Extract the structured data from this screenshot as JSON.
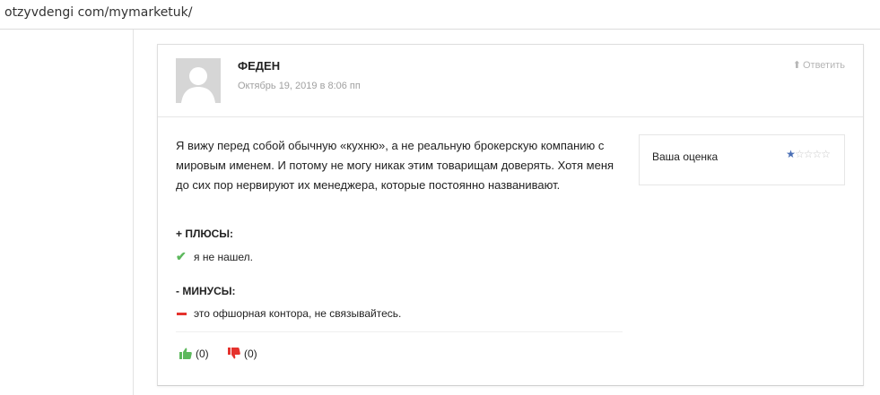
{
  "browser": {
    "url": "otzyvdengi com/mymarketuk/"
  },
  "review": {
    "author": "ФЕДЕН",
    "date": "Октябрь 19, 2019 в 8:06 пп",
    "reply_label": "Ответить",
    "text": "Я вижу перед собой обычную «кухню», а не реальную брокерскую компанию с мировым именем. И потому не могу никак этим товарищам доверять. Хотя меня до сих пор нервируют их менеджера, которые постоянно названивают.",
    "rating": {
      "label": "Ваша оценка",
      "value": 1,
      "max": 5
    },
    "pros": {
      "title": "+ ПЛЮСЫ:",
      "items": [
        "я не нашел."
      ]
    },
    "cons": {
      "title": "- МИНУСЫ:",
      "items": [
        "это офшорная контора, не связывайтесь."
      ]
    },
    "votes": {
      "up": "(0)",
      "down": "(0)"
    }
  },
  "colors": {
    "check": "#5cb85c",
    "minus": "#e5322d",
    "thumb_up": "#5cb85c",
    "thumb_down": "#e5322d",
    "star_active": "#4a6fb5",
    "star_inactive": "#c8c8c8"
  }
}
